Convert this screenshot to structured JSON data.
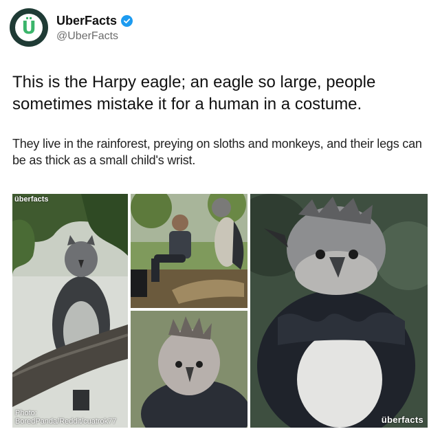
{
  "account": {
    "display_name": "UberFacts",
    "handle": "@UberFacts",
    "avatar_letter": "Ü",
    "verified": true,
    "avatar_colors": {
      "ring": "#1f3b35",
      "letter": "#3bb56b"
    }
  },
  "tweet": {
    "text": "This is the Harpy eagle; an eagle so large, people sometimes mistake it for a human in a costume.",
    "subtext": "They live in the rainforest, preying on sloths and monkeys, and their legs can be as thick as a small child's wrist."
  },
  "media": {
    "watermark_top": "überfacts",
    "photo_credit": "Photo: BoredPanda/Reddit/cuatrok77",
    "watermark_bottom": "überfacts"
  },
  "colors": {
    "verified_badge": "#1d9bf0",
    "text": "#111111",
    "handle": "#6b6b6b"
  }
}
